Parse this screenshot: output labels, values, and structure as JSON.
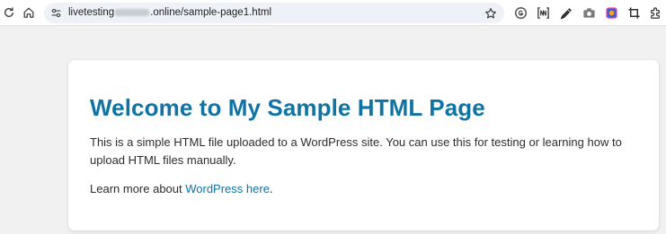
{
  "browser": {
    "url_prefix": "livetesting",
    "url_suffix": ".online/sample-page1.html"
  },
  "page": {
    "heading": "Welcome to My Sample HTML Page",
    "paragraph1": "This is a simple HTML file uploaded to a WordPress site. You can use this for testing or learning how to upload HTML files manually.",
    "learn_more_prefix": "Learn more about ",
    "link_text": "WordPress here",
    "learn_more_suffix": "."
  },
  "colors": {
    "accent": "#0f73a4",
    "page_background": "#f1f1f1",
    "omnibox": "#eef1f8"
  },
  "icons": [
    "reload-icon",
    "home-icon",
    "site-info-icon",
    "bookmark-star-icon",
    "grammarly-extension-icon",
    "bracket-extension-icon",
    "eyedropper-extension-icon",
    "camera-extension-icon",
    "color-extension-icon",
    "crop-extension-icon",
    "extensions-puzzle-icon"
  ]
}
